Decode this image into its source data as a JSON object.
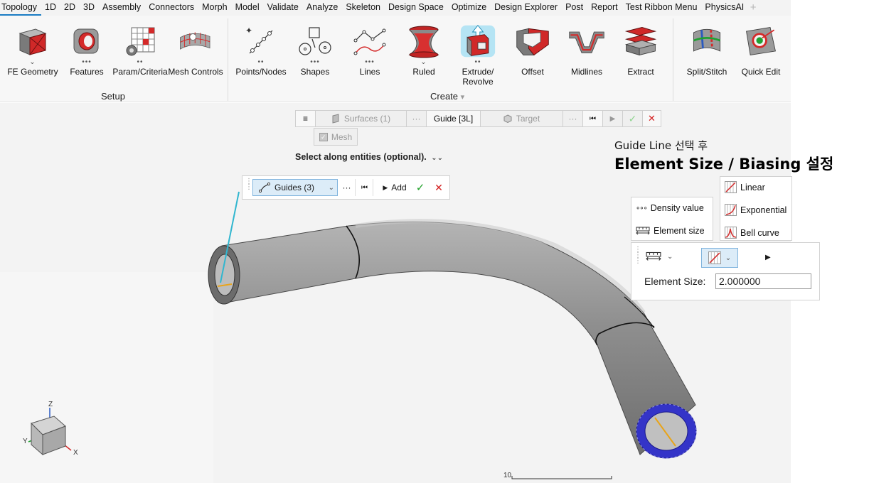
{
  "menu": [
    "Topology",
    "1D",
    "2D",
    "3D",
    "Assembly",
    "Connectors",
    "Morph",
    "Model",
    "Validate",
    "Analyze",
    "Skeleton",
    "Design Space",
    "Optimize",
    "Design Explorer",
    "Post",
    "Report",
    "Test Ribbon Menu",
    "PhysicsAI"
  ],
  "menu_add": "+",
  "ribbon": {
    "setup": {
      "label": "Setup",
      "buttons": [
        {
          "label": "FE Geometry",
          "dots": "⌄",
          "icon": "fe-geometry-icon"
        },
        {
          "label": "Features",
          "dots": "•••",
          "icon": "features-icon"
        },
        {
          "label": "Param/Criteria",
          "dots": "••",
          "icon": "param-criteria-icon"
        },
        {
          "label": "Mesh Controls",
          "dots": "",
          "icon": "mesh-controls-icon"
        }
      ]
    },
    "create": {
      "label": "Create",
      "caret": "▾",
      "buttons": [
        {
          "label": "Points/Nodes",
          "dots": "••",
          "icon": "points-nodes-icon"
        },
        {
          "label": "Shapes",
          "dots": "•••",
          "icon": "shapes-icon"
        },
        {
          "label": "Lines",
          "dots": "•••",
          "icon": "lines-icon"
        },
        {
          "label": "Ruled",
          "dots": "⌄",
          "icon": "ruled-icon"
        },
        {
          "label": "Extrude/\nRevolve",
          "dots": "••",
          "icon": "extrude-revolve-icon"
        },
        {
          "label": "Offset",
          "dots": "",
          "icon": "offset-icon"
        },
        {
          "label": "Midlines",
          "dots": "",
          "icon": "midlines-icon"
        },
        {
          "label": "Extract",
          "dots": "",
          "icon": "extract-icon"
        }
      ]
    },
    "edit": {
      "buttons": [
        {
          "label": "Split/Stitch",
          "dots": "",
          "icon": "split-stitch-icon"
        },
        {
          "label": "Quick Edit",
          "dots": "",
          "icon": "quick-edit-icon"
        }
      ]
    }
  },
  "guide_toolbar": {
    "menu": "≡",
    "surfaces": "Surfaces (1)",
    "more1": "···",
    "guide": "Guide [3L]",
    "target": "Target",
    "more2": "···",
    "first": "⏮",
    "play": "▶",
    "accept": "✓",
    "cancel": "✕",
    "mesh": "Mesh"
  },
  "select_hint": "Select along entities (optional).",
  "select_hint_caret": "⌄⌄",
  "guides_panel": {
    "guides": "Guides (3)",
    "more": "···",
    "first": "⏮",
    "add": "Add",
    "accept": "✓",
    "cancel": "✕"
  },
  "annotation": {
    "line1": "Guide Line 선택 후",
    "line2": "Element Size / Biasing 설정"
  },
  "density_options": [
    "Density value",
    "Element size"
  ],
  "bias_options": [
    "Linear",
    "Exponential",
    "Bell curve"
  ],
  "element_size": {
    "label": "Element Size:",
    "value": "2.000000"
  },
  "scale_label": "10",
  "triad": {
    "z": "Z",
    "y": "Y",
    "x": "X"
  },
  "colors": {
    "accent": "#1a7cc4",
    "guide_line": "#31b6cf",
    "pipe": "#909090",
    "mesh_ring": "#2a2ad0",
    "accept": "#21a12a",
    "cancel": "#d42020"
  }
}
